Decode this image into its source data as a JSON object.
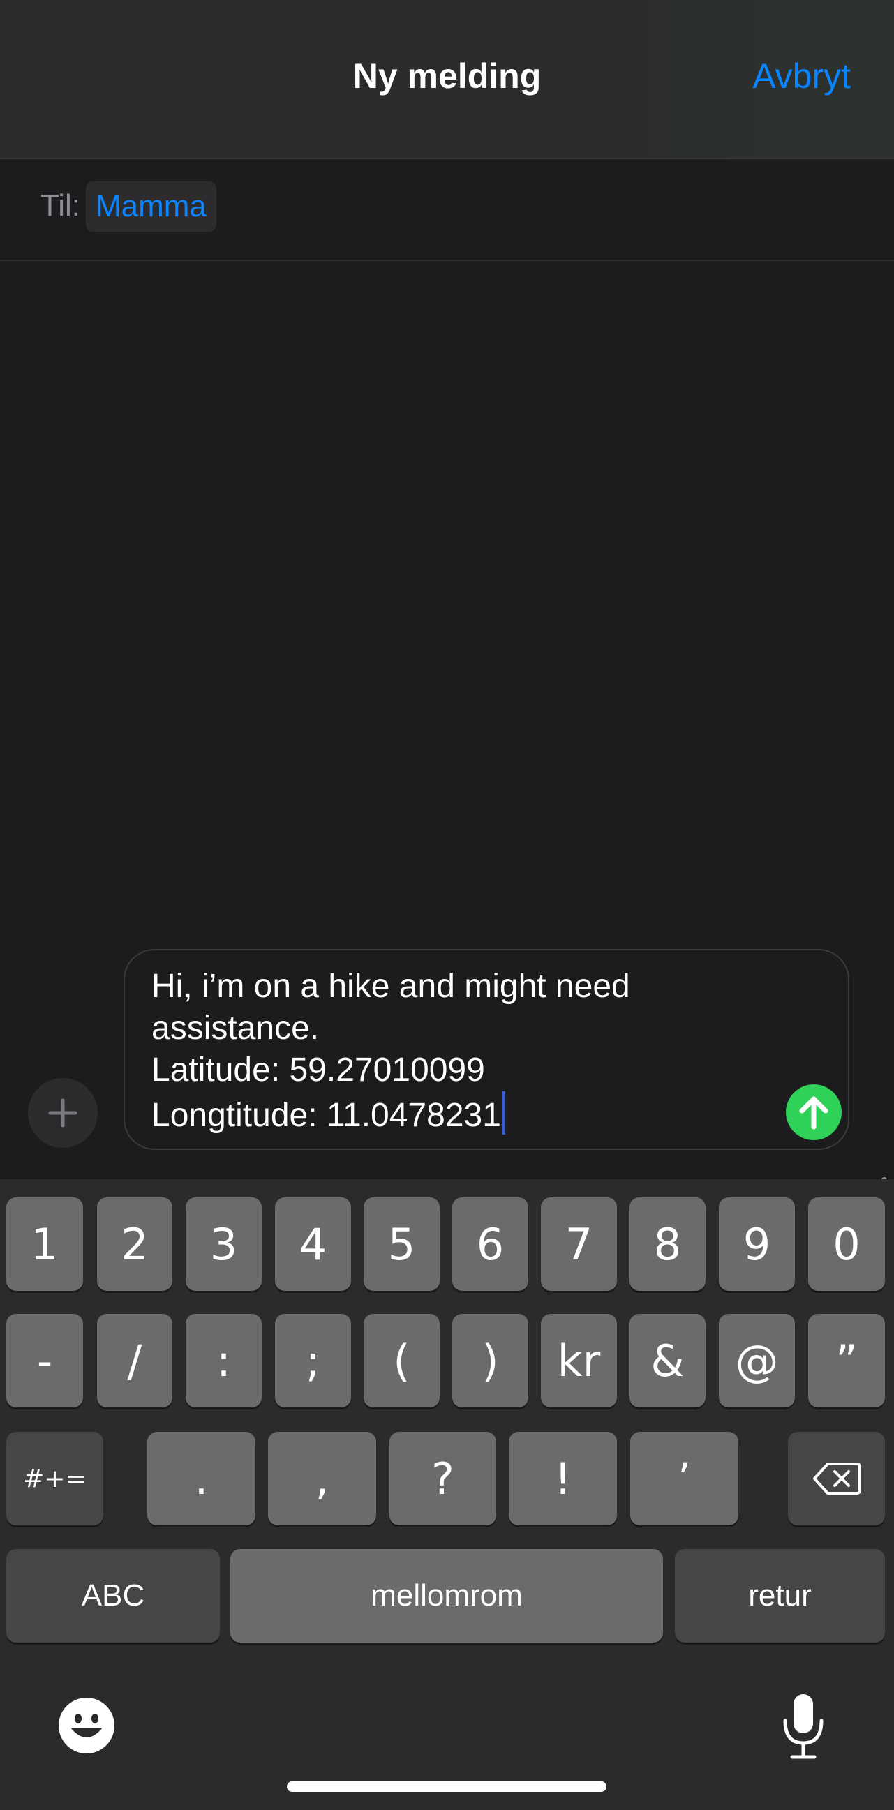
{
  "header": {
    "title": "Ny melding",
    "cancel_label": "Avbryt"
  },
  "recipient": {
    "label": "Til:",
    "name": "Mamma"
  },
  "compose": {
    "message": "Hi, i’m on a hike and might need\nassistance.\nLatitude: 59.27010099\nLongtitude: 11.0478231"
  },
  "keyboard": {
    "row1": [
      "1",
      "2",
      "3",
      "4",
      "5",
      "6",
      "7",
      "8",
      "9",
      "0"
    ],
    "row2": [
      "-",
      "/",
      ":",
      ";",
      "(",
      ")",
      "kr",
      "&",
      "@",
      "”"
    ],
    "row3": {
      "shift_label": "#+=",
      "keys": [
        ".",
        ",",
        "?",
        "!",
        "’"
      ]
    },
    "row4": {
      "abc_label": "ABC",
      "space_label": "mellomrom",
      "return_label": "retur"
    }
  },
  "colors": {
    "accent": "#0a84ff",
    "send": "#30d158",
    "background": "#1c1c1e",
    "key": "#6b6b6b",
    "key_dark": "#464648"
  }
}
